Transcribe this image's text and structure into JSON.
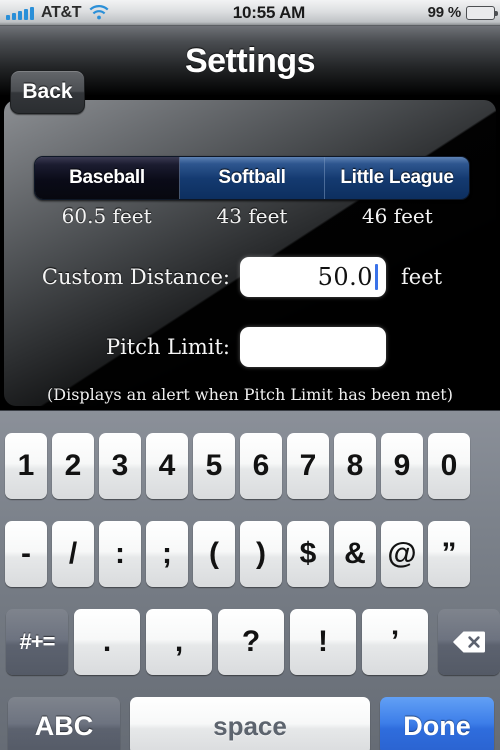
{
  "status_bar": {
    "signal_icon": "signal-bars-icon",
    "carrier": "AT&T",
    "wifi_icon": "wifi-icon",
    "time": "10:55 AM",
    "battery_percent": "99 %",
    "battery_icon": "battery-icon",
    "battery_level": 99,
    "battery_color": "#63c92a"
  },
  "nav_bar": {
    "back_label": "Back",
    "title": "Settings"
  },
  "settings": {
    "segmented_control": {
      "selected_index": 0,
      "options": [
        {
          "label": "Baseball",
          "distance": "60.5 feet"
        },
        {
          "label": "Softball",
          "distance": "43 feet"
        },
        {
          "label": "Little League",
          "distance": "46 feet"
        }
      ]
    },
    "custom_distance": {
      "label": "Custom Distance:",
      "value": "50.0",
      "placeholder": "",
      "unit": "feet",
      "caret_color": "#3a72e8",
      "focused": true
    },
    "pitch_limit": {
      "label": "Pitch Limit:",
      "value": "",
      "placeholder": "",
      "focused": false
    },
    "hint": "(Displays an alert when Pitch Limit has been met)"
  },
  "keyboard": {
    "row1": [
      "1",
      "2",
      "3",
      "4",
      "5",
      "6",
      "7",
      "8",
      "9",
      "0"
    ],
    "row2": [
      "-",
      "/",
      ":",
      ";",
      "(",
      ")",
      "$",
      "&",
      "@",
      "”"
    ],
    "row3_symbol_key": "#+=",
    "row3": [
      ".",
      ",",
      "?",
      "!",
      "’"
    ],
    "row3_backspace_icon": "backspace-icon",
    "row4": {
      "abc_label": "ABC",
      "space_label": "space",
      "done_label": "Done",
      "done_color": "#3d7ee9"
    }
  }
}
